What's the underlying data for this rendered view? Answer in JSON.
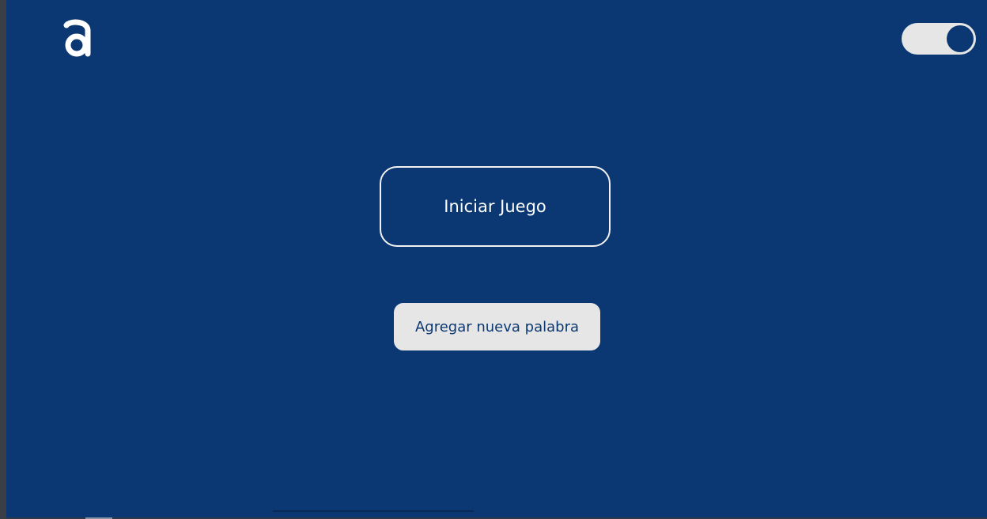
{
  "header": {
    "logo_icon": "letter-a-logo-icon",
    "theme_toggle": {
      "state": "on",
      "icon": "toggle-switch-icon"
    }
  },
  "main": {
    "start_button_label": "Iniciar Juego",
    "add_word_button_label": "Agregar nueva palabra"
  },
  "colors": {
    "background": "#0b3872",
    "button_light": "#e6e6e6",
    "button_border": "#f2f2f2",
    "text_light": "#ffffff",
    "text_dark": "#0b3872"
  }
}
